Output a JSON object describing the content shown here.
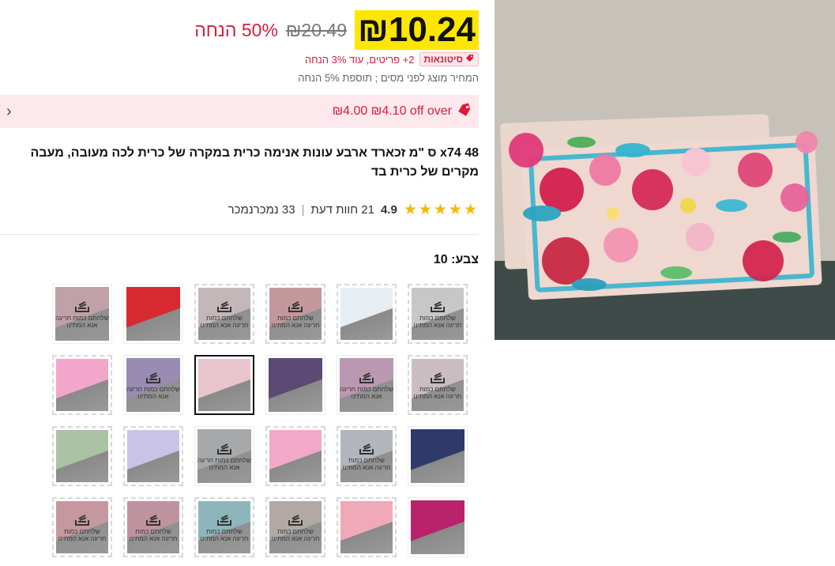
{
  "price": {
    "current": "₪10.24",
    "original": "₪20.49",
    "discount": "50% הנחה"
  },
  "promo": {
    "badge": "סיטונאות",
    "text": "2+ פריטים, עוד 3% הנחה"
  },
  "tax_note": "המחיר מוצג לפני מסים ; תוספת 5% הנחה",
  "coupon": {
    "text": "₪4.00 ₪4.10 off over"
  },
  "product": {
    "title": "48 x74 ס \"מ זכארד ארבע עונות אנימה כרית במקרה של כרית לכה מעובה, מעבה מקרים של כרית בד"
  },
  "rating": {
    "value": "4.9",
    "stars": "★★★★★",
    "reviews": "21 חוות דעת",
    "separator": "|",
    "sold": "33 נמכרנמכר"
  },
  "color": {
    "label": "צבע: 10"
  },
  "thumbnails": [
    {
      "overlay_text": "שלחתם כמות חריגה אנא המתינו",
      "style": "dashed",
      "bg": "#f1eef0"
    },
    {
      "overlay_text": "",
      "style": "dashed",
      "bg": "#e7eef3"
    },
    {
      "overlay_text": "שלחתם כמות חריגה אנא המתינו",
      "style": "dashed",
      "bg": "#e89aa0"
    },
    {
      "overlay_text": "שלחתם כמות חריגה אנא המתינו",
      "style": "dashed",
      "bg": "#e7d2d6"
    },
    {
      "overlay_text": "",
      "style": "solid",
      "bg": "#d7292f"
    },
    {
      "overlay_text": "שלחתם כמות חריגה אנא המתינו",
      "style": "solid",
      "bg": "#e2a9b6"
    },
    {
      "overlay_text": "שלחתם כמות חריגה אנא המתינו",
      "style": "dashed",
      "bg": "#f3dde6"
    },
    {
      "overlay_text": "שלחתם כמות חריגה אנא המתינו",
      "style": "solid",
      "bg": "#d99ac8"
    },
    {
      "overlay_text": "",
      "style": "solid",
      "bg": "#5b4a73"
    },
    {
      "overlay_text": "",
      "style": "selected",
      "bg": "#e8c4cc"
    },
    {
      "overlay_text": "שלחתם כמות חריגה אנא המתינו",
      "style": "solid",
      "bg": "#9a84c8"
    },
    {
      "overlay_text": "",
      "style": "dashed",
      "bg": "#f2a6c9"
    },
    {
      "overlay_text": "",
      "style": "solid",
      "bg": "#2f3a6a"
    },
    {
      "overlay_text": "שלחתם כמות חריגה אנא המתינו",
      "style": "dashed",
      "bg": "#c9cfda"
    },
    {
      "overlay_text": "",
      "style": "dashed",
      "bg": "#f2a9c7"
    },
    {
      "overlay_text": "שלחתם כמות חריגה אנא המתינו",
      "style": "solid",
      "bg": "#b4b6b9"
    },
    {
      "overlay_text": "",
      "style": "dashed",
      "bg": "#c9c3e8"
    },
    {
      "overlay_text": "",
      "style": "dashed",
      "bg": "#a9c3a4"
    },
    {
      "overlay_text": "",
      "style": "solid",
      "bg": "#b8226a"
    },
    {
      "overlay_text": "",
      "style": "dashed",
      "bg": "#f0a9b8"
    },
    {
      "overlay_text": "שלחתם כמות חריגה אנא המתינו",
      "style": "dashed",
      "bg": "#c9b8b0"
    },
    {
      "overlay_text": "שלחתם כמות חריגה אנא המתינו",
      "style": "dashed",
      "bg": "#86d0da"
    },
    {
      "overlay_text": "שלחתם כמות חריגה אנא המתינו",
      "style": "dashed",
      "bg": "#e090a6"
    },
    {
      "overlay_text": "שלחתם כמות חריגה אנא המתינו",
      "style": "dashed",
      "bg": "#ec9aa6"
    }
  ]
}
